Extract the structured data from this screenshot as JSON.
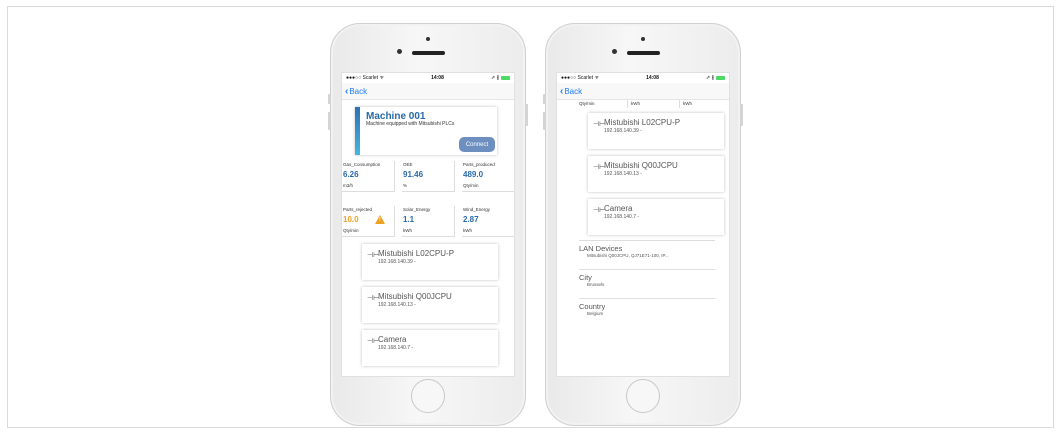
{
  "status_bar": {
    "carrier": "●●●○○ Scarlet ᯤ",
    "time": "14:08",
    "right": "⇗ ∦"
  },
  "nav": {
    "back_label": "Back"
  },
  "machine": {
    "title": "Machine 001",
    "subtitle": "Machine equipped with Mitsubishi PLCs",
    "connect_label": "Connect"
  },
  "metrics_row1": [
    {
      "name": "Gas_Consumption",
      "value": "6.26",
      "unit": "m3/h"
    },
    {
      "name": "OEE",
      "value": "91.46",
      "unit": "%"
    },
    {
      "name": "Parts_produced",
      "value": "489.0",
      "unit": "Qty/min"
    }
  ],
  "metrics_row2": [
    {
      "name": "Parts_rejected",
      "value": "10.0",
      "unit": "Qty/min"
    },
    {
      "name": "Solar_Energy",
      "value": "1.1",
      "unit": "kWh"
    },
    {
      "name": "Wind_Energy",
      "value": "2.87",
      "unit": "kWh"
    }
  ],
  "devices": [
    {
      "name": "Mistubishi L02CPU-P",
      "ip": "192.168.140.39 -"
    },
    {
      "name": "Mitsubishi Q00JCPU",
      "ip": "192.168.140.13 -"
    },
    {
      "name": "Camera",
      "ip": "192.168.140.7 -"
    }
  ],
  "column_headers": [
    "Qty/min",
    "kWh",
    "kWh"
  ],
  "info": [
    {
      "label": "LAN Devices",
      "value": "Mitsubishi Q00JCPU, QJ71E71-100, IP..."
    },
    {
      "label": "City",
      "value": "Brussels"
    },
    {
      "label": "Country",
      "value": "Belgium"
    }
  ],
  "colors": {
    "accent": "#2a6aa9",
    "ios_blue": "#1c7cf4",
    "warning": "#f0a020",
    "button": "#6c8fc0"
  }
}
